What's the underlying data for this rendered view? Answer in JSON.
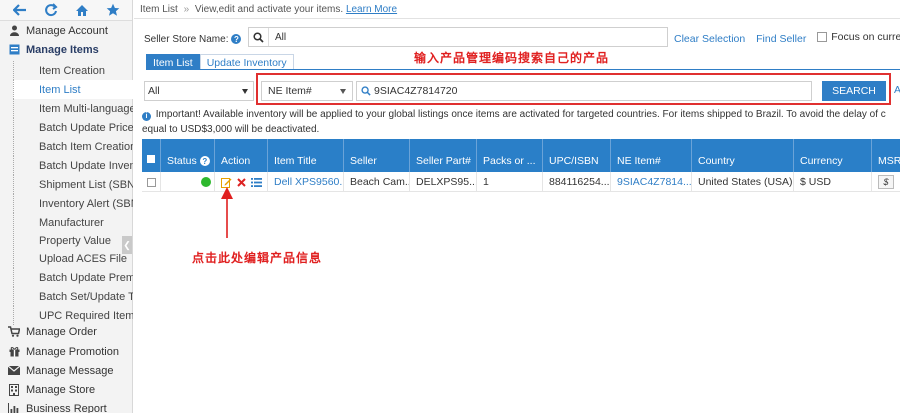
{
  "sidebar": {
    "nav_icons": [
      "back-arrow-icon",
      "refresh-icon",
      "home-icon",
      "star-icon"
    ],
    "items": [
      {
        "label": "Manage Account",
        "icon": "user-icon",
        "level": "top"
      },
      {
        "label": "Manage Items",
        "icon": "items-icon",
        "level": "top",
        "active": true
      },
      {
        "label": "Item Creation",
        "level": "sub"
      },
      {
        "label": "Item List",
        "level": "sub",
        "active": true
      },
      {
        "label": "Item Multi-language ...",
        "level": "sub"
      },
      {
        "label": "Batch Update Price",
        "level": "sub"
      },
      {
        "label": "Batch Item Creation...",
        "level": "sub"
      },
      {
        "label": "Batch Update Invent...",
        "level": "sub"
      },
      {
        "label": "Shipment List (SBN ...",
        "level": "sub"
      },
      {
        "label": "Inventory Alert (SBN...",
        "level": "sub"
      },
      {
        "label": "Manufacturer",
        "level": "sub"
      },
      {
        "label": "Property Value",
        "level": "sub"
      },
      {
        "label": "Upload ACES File",
        "level": "sub"
      },
      {
        "label": "Batch Update Premi...",
        "level": "sub"
      },
      {
        "label": "Batch Set/Update T...",
        "level": "sub"
      },
      {
        "label": "UPC Required Item ...",
        "level": "sub"
      },
      {
        "label": "Manage Order",
        "icon": "cart-icon",
        "level": "top"
      },
      {
        "label": "Manage Promotion",
        "icon": "gift-icon",
        "level": "top"
      },
      {
        "label": "Manage Message",
        "icon": "envelope-icon",
        "level": "top"
      },
      {
        "label": "Manage Store",
        "icon": "store-icon",
        "level": "top"
      },
      {
        "label": "Business Report",
        "icon": "bar-chart-icon",
        "level": "top"
      }
    ]
  },
  "breadcrumb": {
    "section": "Item List",
    "separator": "»",
    "description": "View,edit and activate your items.",
    "link": "Learn More"
  },
  "store": {
    "label": "Seller Store Name:",
    "value": "All",
    "clear_selection": "Clear Selection",
    "find_seller": "Find Seller",
    "focus_label": "Focus on current"
  },
  "tabs": [
    {
      "label": "Item List",
      "active": true
    },
    {
      "label": "Update Inventory",
      "active": false
    }
  ],
  "annotations": {
    "top": "输入产品管理编码搜索自己的产品",
    "bottom": "点击此处编辑产品信息"
  },
  "search": {
    "filter_value": "All",
    "field_value": "NE Item#",
    "query": "9SIAC4Z7814720",
    "button": "SEARCH",
    "advanced_link": "A"
  },
  "notice": "Important! Available inventory will be applied to your global listings once items are activated for targeted countries. For items shipped to Brazil. To avoid the delay of customs clearance, any item price greater than or equal to USD$3,000 will be deactivated.",
  "notice_line1": "Important! Available inventory will be applied to your global listings once items are activated for targeted countries. For items shipped to Brazil. To avoid the delay of c",
  "notice_line2": "equal to USD$3,000 will be deactivated.",
  "table": {
    "headers": [
      "Status",
      "Action",
      "Item Title",
      "Seller",
      "Seller Part#",
      "Packs or ...",
      "UPC/ISBN",
      "NE Item#",
      "Country",
      "Currency",
      "MSR"
    ],
    "rows": [
      {
        "status": "green",
        "item_title": "Dell XPS9560...",
        "seller": "Beach Cam...",
        "seller_part": "DELXPS95...",
        "packs": "1",
        "upc": "884116254...",
        "ne_item": "9SIAC4Z7814...",
        "country": "United States (USA)",
        "currency": "$ USD",
        "msrp_button": "$"
      }
    ]
  },
  "colors": {
    "accent": "#2f7ec6",
    "header_bg": "#2a7fc8",
    "annotation_red": "#e02020",
    "status_green": "#2eb82e"
  }
}
